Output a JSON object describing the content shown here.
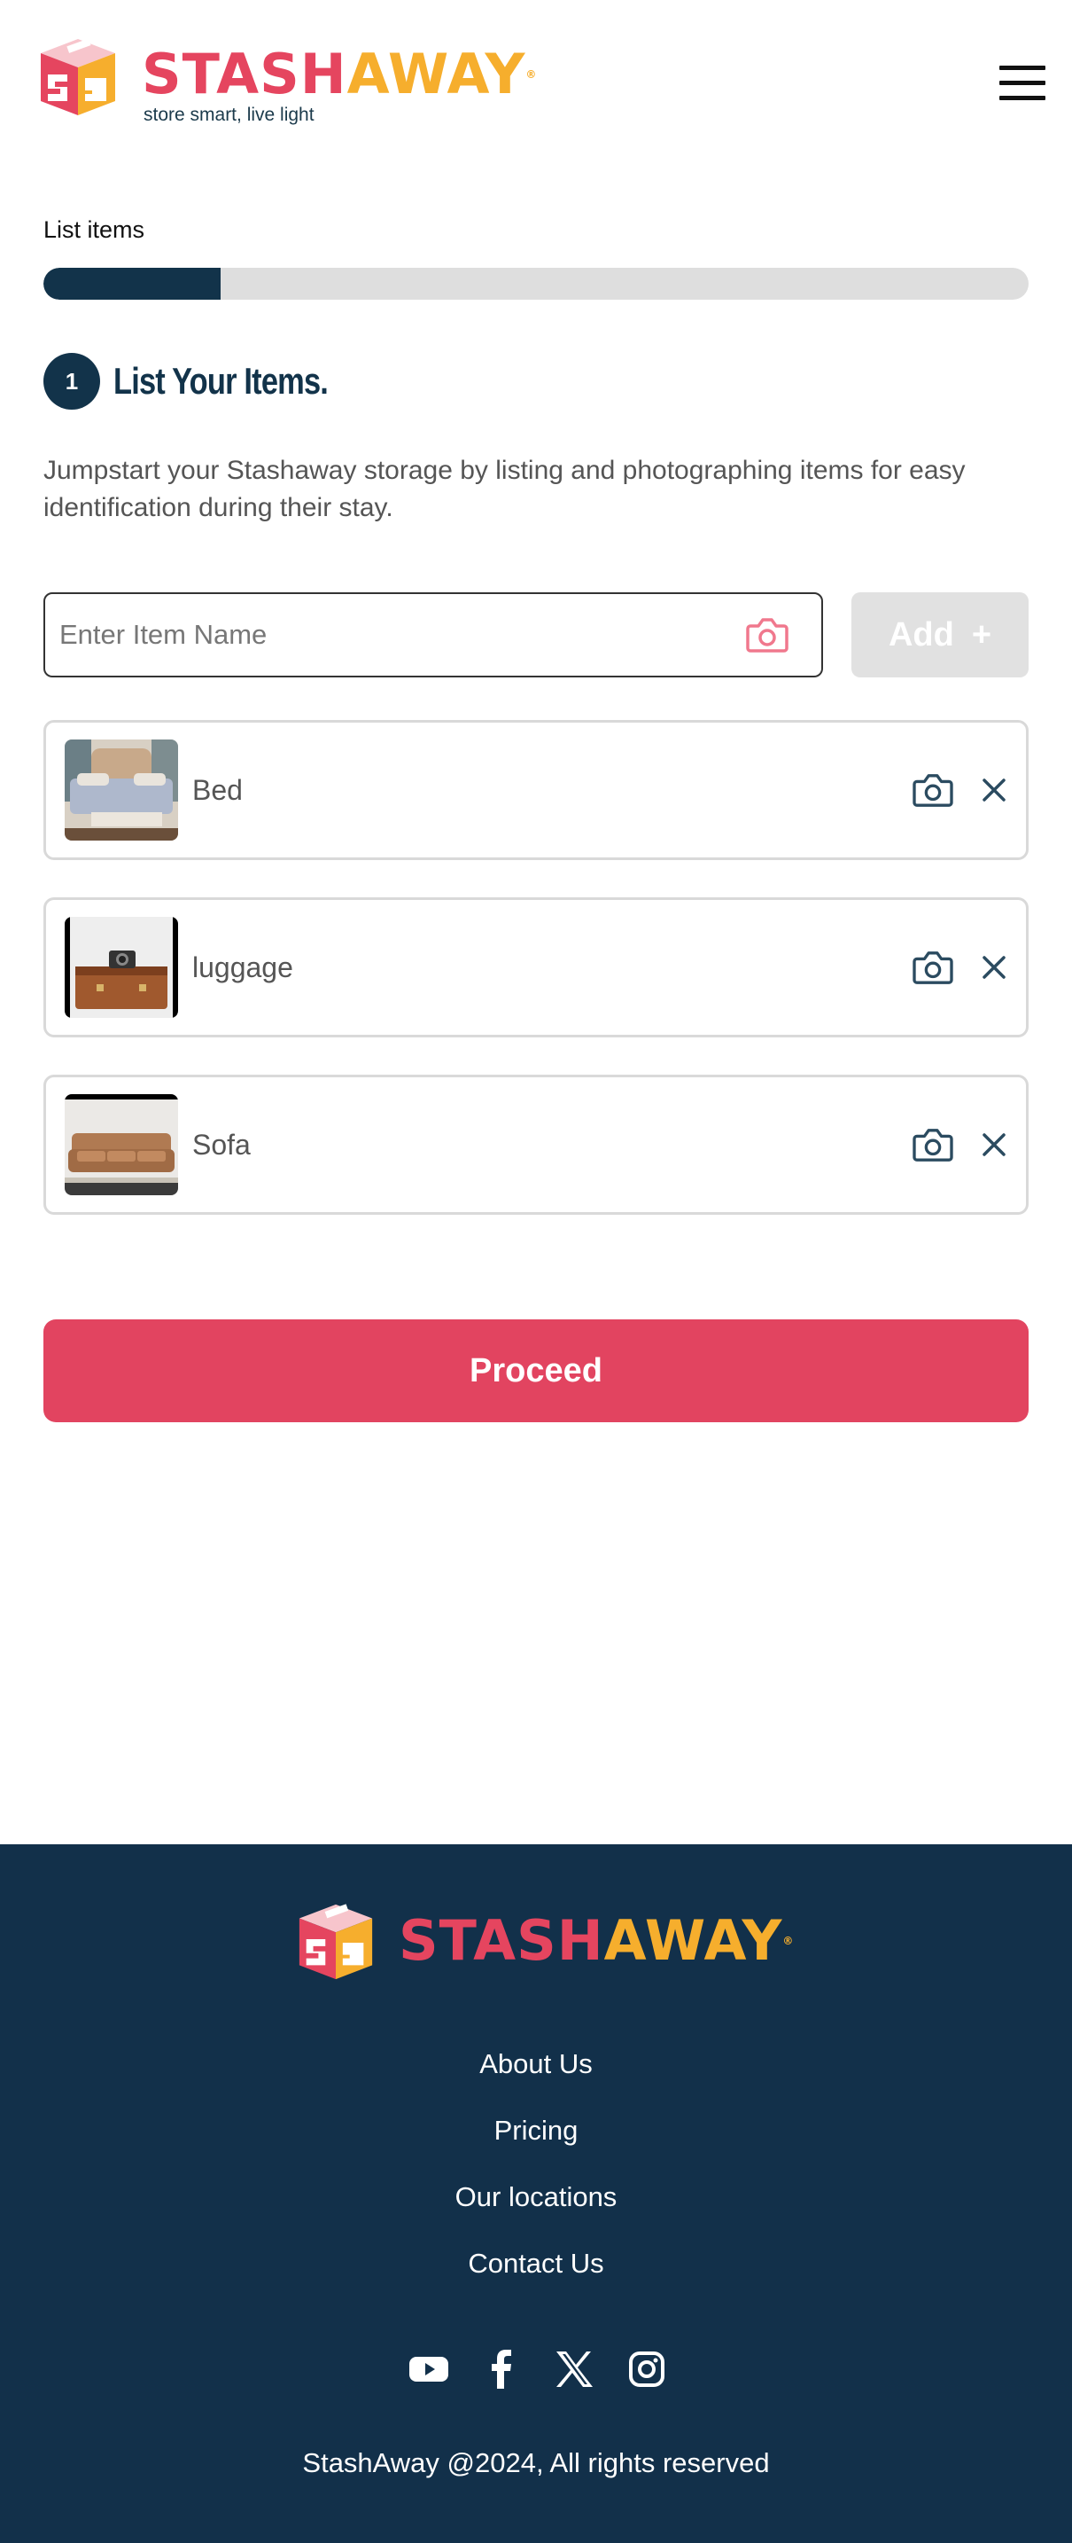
{
  "brand": {
    "name_part1": "STASH",
    "name_part2": "AWAY",
    "trademark": "®",
    "tagline": "store smart, live light",
    "colors": {
      "pink": "#e5455f",
      "orange": "#f6ae2d",
      "navy": "#12334a"
    }
  },
  "progress": {
    "label": "List items",
    "fraction": 0.18
  },
  "step": {
    "number": "1",
    "title": "List Your Items.",
    "description": "Jumpstart your Stashaway storage by listing and photographing items for easy identification during their stay."
  },
  "item_input": {
    "placeholder": "Enter Item Name",
    "value": "",
    "camera_icon": "camera-icon",
    "add_label": "Add",
    "add_symbol": "+"
  },
  "items": [
    {
      "name": "Bed",
      "thumb": "bed-photo"
    },
    {
      "name": "luggage",
      "thumb": "luggage-photo"
    },
    {
      "name": "Sofa",
      "thumb": "sofa-photo"
    }
  ],
  "proceed_label": "Proceed",
  "footer": {
    "links": [
      "About Us",
      "Pricing",
      "Our locations",
      "Contact Us"
    ],
    "socials": [
      "youtube-icon",
      "facebook-icon",
      "x-icon",
      "instagram-icon"
    ],
    "copyright": "StashAway @2024, All rights reserved"
  }
}
